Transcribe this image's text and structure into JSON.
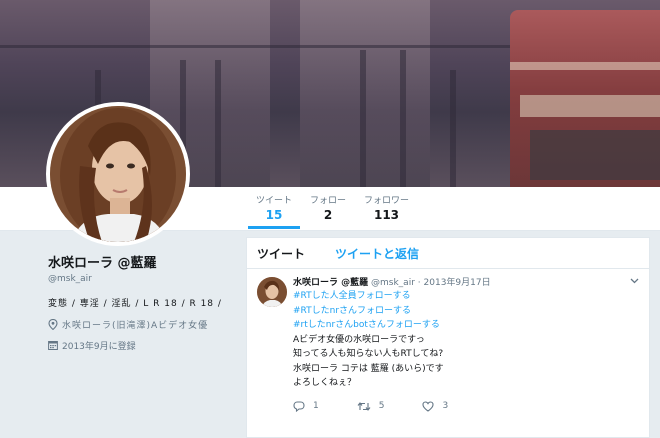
{
  "profile": {
    "name": "水咲ローラ @藍羅",
    "handle": "@msk_air",
    "bio": "変態 / 専淫 / 淫乱 / L R 18 / R 18 /",
    "location": "水咲ローラ(旧滝澤)Aビデオ女優",
    "joined": "2013年9月に登録"
  },
  "stats": [
    {
      "label": "ツイート",
      "value": "15"
    },
    {
      "label": "フォロー",
      "value": "2"
    },
    {
      "label": "フォロワー",
      "value": "113"
    }
  ],
  "tabs": {
    "tweets": "ツイート",
    "tweets_replies": "ツイートと返信"
  },
  "tweet": {
    "name": "水咲ローラ @藍羅",
    "handle": "@msk_air",
    "sep": "·",
    "date": "2013年9月17日",
    "hashtags": [
      "#RTした人全員フォローする",
      "#RTしたnrさんフォローする",
      "#rtしたnrさんbotさんフォローする"
    ],
    "line1": "Aビデオ女優の水咲ローラですっ",
    "line2": "知ってる人も知らない人もRTしてね?",
    "line3": "水咲ローラ コテは 藍羅 (あいら)です",
    "line4": "よろしくねぇ？",
    "replies": "1",
    "retweets": "5",
    "likes": "3"
  },
  "icons": {
    "location": "location-pin-icon",
    "calendar": "calendar-icon",
    "reply": "reply-icon",
    "retweet": "retweet-icon",
    "like": "heart-icon",
    "more": "chevron-down-icon"
  },
  "colors": {
    "accent": "#1da1f2",
    "text": "#14171a",
    "muted": "#657786",
    "bg": "#e6ecf0"
  }
}
